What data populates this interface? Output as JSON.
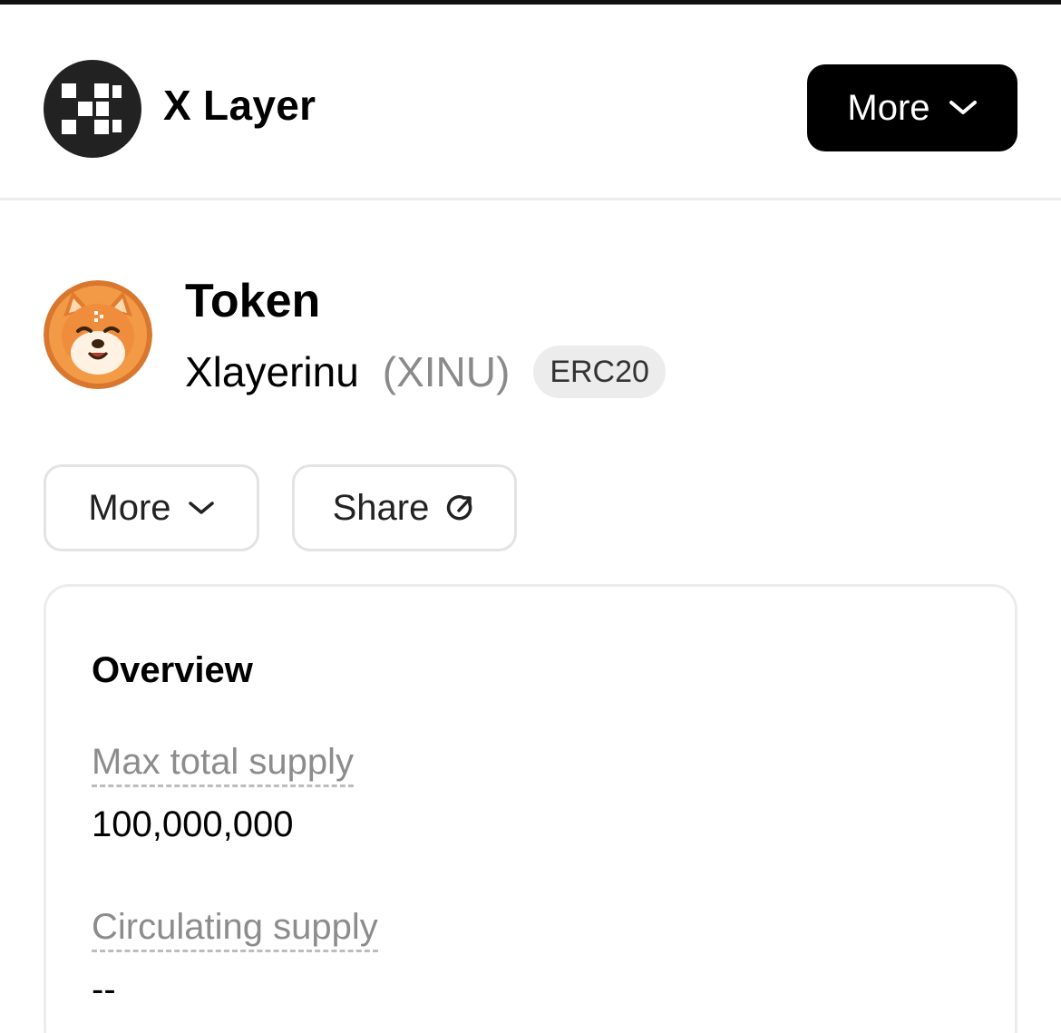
{
  "header": {
    "brand": "X Layer",
    "logo_icon": "x-layer-logo-icon",
    "more_label": "More"
  },
  "token": {
    "title": "Token",
    "name": "Xlayerinu",
    "symbol": "(XINU)",
    "standard_badge": "ERC20",
    "avatar_icon": "shiba-inu-avatar-icon"
  },
  "actions": {
    "more_label": "More",
    "share_label": "Share"
  },
  "overview": {
    "title": "Overview",
    "max_total_supply_label": "Max total supply",
    "max_total_supply_value": "100,000,000",
    "circulating_supply_label": "Circulating supply",
    "circulating_supply_value": "--"
  },
  "colors": {
    "primary_button_bg": "#000000",
    "muted_text": "#8a8a8a",
    "badge_bg": "#ececec",
    "border": "#e3e3e3",
    "avatar_orange": "#d9772e"
  }
}
